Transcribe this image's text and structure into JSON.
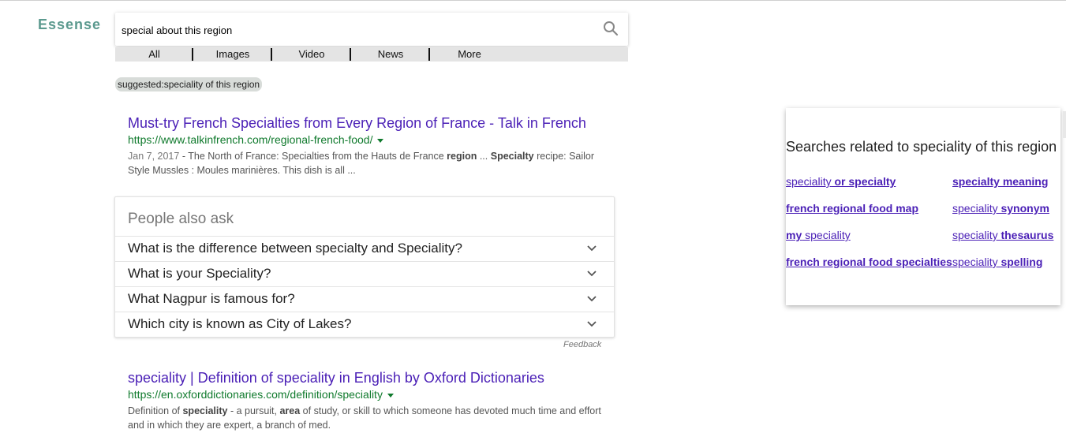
{
  "logo": "Essense",
  "search": {
    "value": "special about this region"
  },
  "tabs": [
    "All",
    "Images",
    "Video",
    "News",
    "More"
  ],
  "suggestion": "suggested:speciality of this region",
  "results": [
    {
      "title": "Must-try French Specialties from Every Region of France - Talk in French",
      "url": "https://www.talkinfrench.com/regional-french-food/",
      "date": "Jan 7, 2017",
      "snippet_parts": [
        " - The North of France: Specialties from the Hauts de France ",
        "region",
        " ... ",
        "Specialty",
        " recipe: Sailor Style Mussles : Moules marinières. This dish is all ..."
      ]
    },
    {
      "title": "speciality | Definition of speciality in English by Oxford Dictionaries",
      "url": "https://en.oxforddictionaries.com/definition/speciality",
      "date": "",
      "snippet_parts": [
        "Definition of ",
        "speciality",
        " - a pursuit, ",
        "area",
        " of study, or skill to which someone has devoted much time and effort and in which they are expert, a branch of med."
      ]
    }
  ],
  "people_also_ask": {
    "title": "People also ask",
    "questions": [
      "What is the difference between specialty and Speciality?",
      "What is your Speciality?",
      "What Nagpur is famous for?",
      "Which city is known as City of Lakes?"
    ],
    "feedback": "Feedback"
  },
  "related": {
    "title": "Searches related to speciality of this region",
    "links": [
      {
        "plain": "speciality",
        "bold": " or specialty"
      },
      {
        "plain": "",
        "bold": "specialty meaning"
      },
      {
        "plain": "",
        "bold": "french regional food map"
      },
      {
        "plain": "speciality ",
        "bold": "synonym"
      },
      {
        "plain": "",
        "bold": "my",
        "plain_after": " speciality"
      },
      {
        "plain": "speciality ",
        "bold": "thesaurus"
      },
      {
        "plain": "",
        "bold": "french regional food specialties"
      },
      {
        "plain": "speciality ",
        "bold": "spelling"
      }
    ]
  },
  "colors": {
    "link": "#4a1fb6",
    "url": "#107a2d",
    "logo": "#5c9a8f"
  }
}
